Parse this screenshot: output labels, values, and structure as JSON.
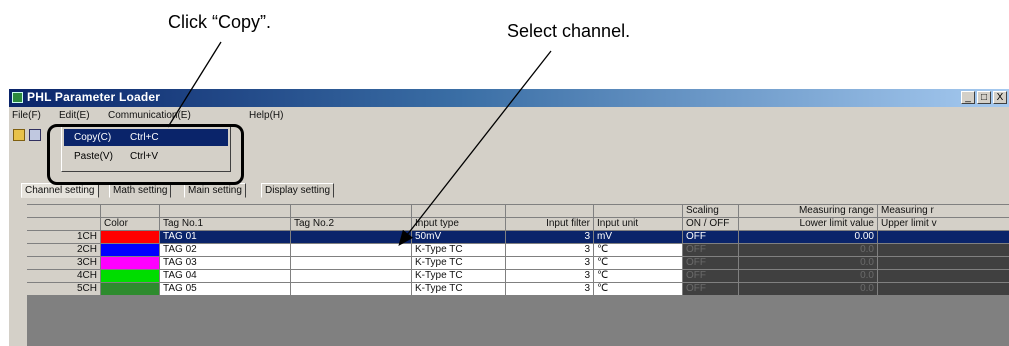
{
  "annotations": {
    "click_copy": "Click “Copy”.",
    "select_channel": "Select channel."
  },
  "window": {
    "title": "PHL Parameter Loader",
    "buttons": [
      "_",
      "□",
      "X"
    ]
  },
  "menu": [
    "File(F)",
    "Edit(E)",
    "Communication(E)",
    "Help(H)"
  ],
  "dropdown": [
    {
      "label": "Copy(C)",
      "shortcut": "Ctrl+C",
      "selected": true
    },
    {
      "label": "Paste(V)",
      "shortcut": "Ctrl+V",
      "selected": false
    }
  ],
  "tabs": [
    "Channel setting",
    "Math setting",
    "Main setting",
    "Display setting"
  ],
  "table": {
    "header_top": [
      "",
      "",
      "",
      "",
      "",
      "",
      "",
      "Scaling",
      "Measuring range",
      "Measuring r"
    ],
    "header_bottom": [
      "",
      "Color",
      "Tag No.1",
      "Tag No.2",
      "Input type",
      "Input filter",
      "Input unit",
      "ON / OFF",
      "Lower limit value",
      "Upper limit v"
    ],
    "rows": [
      {
        "ch": "1CH",
        "color": "#ff0000",
        "tag1": "TAG 01",
        "tag2": "",
        "input_type": "50mV",
        "filter": "3",
        "unit": "mV",
        "scaling": "OFF",
        "lower": "0.00",
        "upper": "",
        "selected": true
      },
      {
        "ch": "2CH",
        "color": "#0000ff",
        "tag1": "TAG 02",
        "tag2": "",
        "input_type": "K-Type TC",
        "filter": "3",
        "unit": "℃",
        "scaling": "OFF",
        "lower": "0.0",
        "upper": "",
        "selected": false
      },
      {
        "ch": "3CH",
        "color": "#ff00ff",
        "tag1": "TAG 03",
        "tag2": "",
        "input_type": "K-Type TC",
        "filter": "3",
        "unit": "℃",
        "scaling": "OFF",
        "lower": "0.0",
        "upper": "",
        "selected": false
      },
      {
        "ch": "4CH",
        "color": "#00dd00",
        "tag1": "TAG 04",
        "tag2": "",
        "input_type": "K-Type TC",
        "filter": "3",
        "unit": "℃",
        "scaling": "OFF",
        "lower": "0.0",
        "upper": "",
        "selected": false
      },
      {
        "ch": "5CH",
        "color": "#2e8b2e",
        "tag1": "TAG 05",
        "tag2": "",
        "input_type": "K-Type TC",
        "filter": "3",
        "unit": "℃",
        "scaling": "OFF",
        "lower": "0.0",
        "upper": "",
        "selected": false
      }
    ]
  },
  "colors": {
    "selection": "#0a246a",
    "dark_cell": "#404040"
  }
}
